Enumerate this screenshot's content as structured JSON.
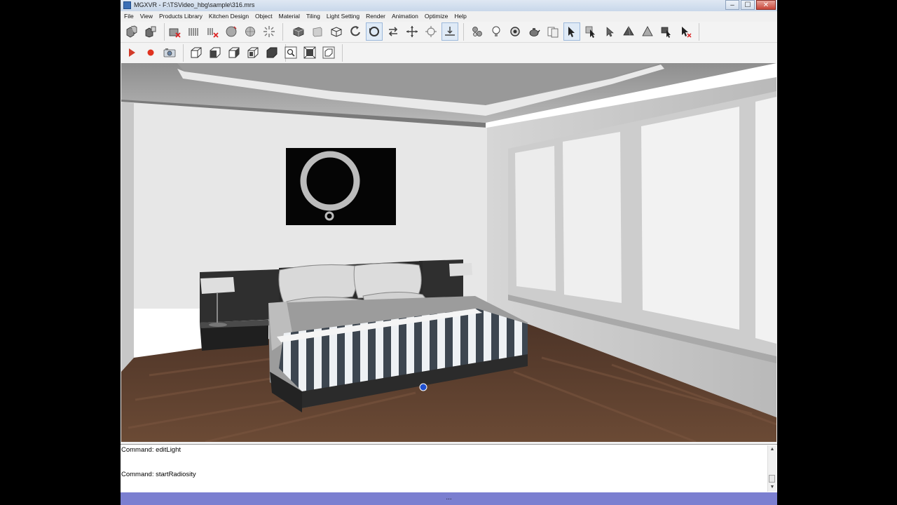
{
  "window": {
    "title": "MGXVR - F:\\TSVideo_hbg\\sample\\316.mrs",
    "minimize_glyph": "–",
    "maximize_glyph": "☐",
    "close_glyph": "✕"
  },
  "menu": {
    "items": [
      "File",
      "View",
      "Products Library",
      "Kitchen Design",
      "Object",
      "Material",
      "Tiling",
      "Light Setting",
      "Render",
      "Animation",
      "Optimize",
      "Help"
    ]
  },
  "toolbar_row1": {
    "groups": [
      [
        "copy-object-icon",
        "paste-object-icon"
      ],
      [
        "delete-object-icon",
        "hide-object-icon",
        "delete-hidden-icon",
        "render-sphere-icon",
        "render-sphere-alt-icon",
        "radiosity-burst-icon"
      ],
      [
        "box-solid-icon",
        "wall-panel-icon",
        "box-wire-icon",
        "rotate-icon",
        "orbit-icon",
        "swap-icon",
        "move-arrows-icon",
        "center-target-icon",
        "ground-level-icon"
      ],
      [
        "spheres-icon",
        "light-bulb-icon",
        "spotlight-icon",
        "teapot-icon",
        "documents-icon",
        "select-arrow-icon",
        "select-box-icon",
        "select-arrow-alt-icon",
        "cone-icon",
        "pyramid-icon",
        "select-cross-icon",
        "select-delete-icon"
      ]
    ]
  },
  "toolbar_row2": {
    "groups": [
      [
        "play-icon",
        "record-icon",
        "camera-icon"
      ],
      [
        "view-perspective-icon",
        "view-front-icon",
        "view-left-icon",
        "view-back-icon",
        "view-top-icon"
      ],
      [
        "zoom-icon",
        "zoom-extents-icon",
        "zoom-window-icon"
      ]
    ]
  },
  "command_log": {
    "lines": [
      "Command: editLight",
      "Command: startRadiosity"
    ]
  },
  "status": {
    "text": "..."
  },
  "colors": {
    "statusbar": "#7b7fd0",
    "floor": "#5a3d2c",
    "wall": "#e6e6e6"
  }
}
